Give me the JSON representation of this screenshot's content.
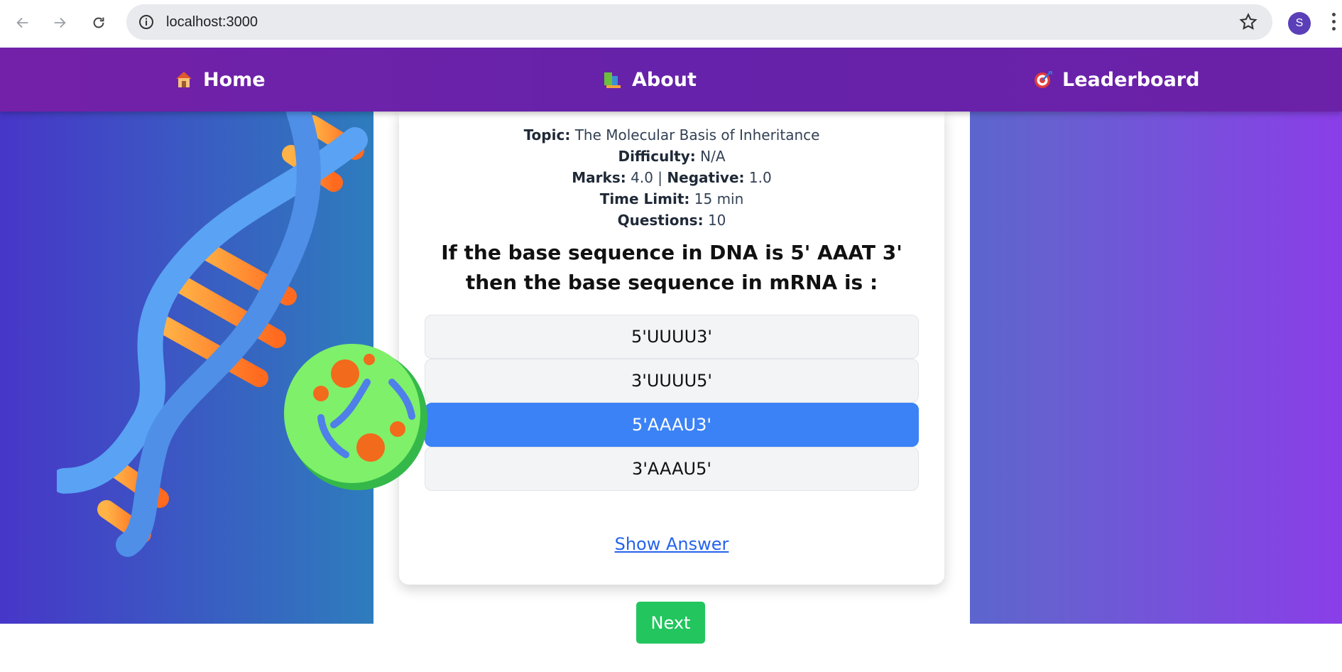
{
  "browser": {
    "url": "localhost:3000",
    "profile_initial": "S"
  },
  "nav": {
    "items": [
      {
        "label": "Home",
        "icon": "house-icon"
      },
      {
        "label": "About",
        "icon": "books-icon"
      },
      {
        "label": "Leaderboard",
        "icon": "target-icon"
      }
    ]
  },
  "quiz": {
    "topic_label": "Topic:",
    "topic": "The Molecular Basis of Inheritance",
    "difficulty_label": "Difficulty:",
    "difficulty": "N/A",
    "marks_label": "Marks:",
    "marks": "4.0",
    "separator": "|",
    "negative_label": "Negative:",
    "negative": "1.0",
    "time_limit_label": "Time Limit:",
    "time_limit": "15 min",
    "questions_label": "Questions:",
    "questions": "10",
    "question_text": "If the base sequence in DNA is 5' AAAT 3' then the base sequence in mRNA is :",
    "options": [
      "5'UUUU3'",
      "3'UUUU5'",
      "5'AAAU3'",
      "3'AAAU5'"
    ],
    "selected_option": 2,
    "show_answer_label": "Show Answer",
    "next_label": "Next"
  },
  "colors": {
    "nav_bg": "#6b21a8",
    "selected_option": "#3b82f6",
    "next_button": "#22c55e",
    "link": "#2563eb"
  }
}
